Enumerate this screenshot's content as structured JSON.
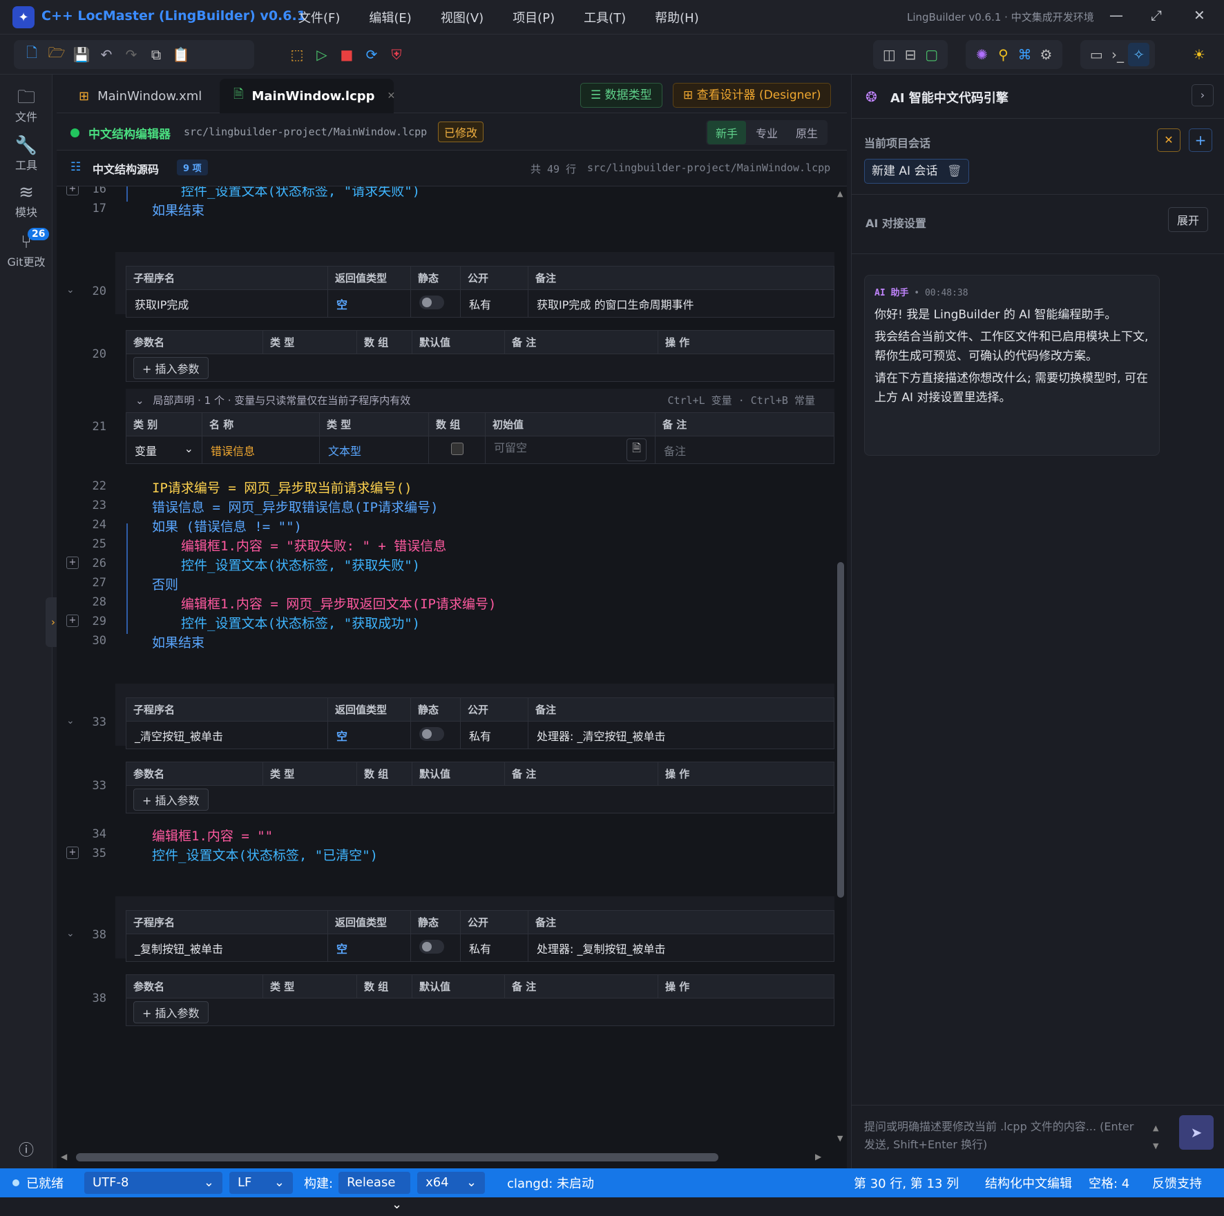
{
  "app": {
    "logo": "logo-icon",
    "title": "C++ LocMaster (LingBuilder) v0.6.1",
    "window_title": "LingBuilder v0.6.1 · 中文集成开发环境",
    "menu": [
      "文件(F)",
      "编辑(E)",
      "视图(V)",
      "项目(P)",
      "工具(T)",
      "帮助(H)"
    ]
  },
  "activity": {
    "files": "文件",
    "tools": "工具",
    "modules": "模块",
    "git": "Git更改",
    "git_badge": "26"
  },
  "tabs": [
    {
      "label": "MainWindow.xml"
    },
    {
      "label": "MainWindow.lcpp"
    }
  ],
  "tab_actions": {
    "data_types": "数据类型",
    "designer": "查看设计器 (Designer)"
  },
  "crumb": {
    "editor_name": "中文结构编辑器",
    "path": "src/lingbuilder-project/MainWindow.lcpp",
    "modified": "已修改",
    "modes": [
      "新手",
      "专业",
      "原生"
    ],
    "active_mode": "新手"
  },
  "source": {
    "title": "中文结构源码",
    "count": "9 项",
    "lines": "共 49 行",
    "path": "src/lingbuilder-project/MainWindow.lcpp"
  },
  "code_top": {
    "l16_num": "16",
    "l16": "控件_设置文本(状态标签, \"请求失败\")",
    "l17_num": "17",
    "l17": "如果结束"
  },
  "sub_headers": [
    "子程序名",
    "返回值类型",
    "静态",
    "公开",
    "备注"
  ],
  "param_headers": [
    "参数名",
    "类 型",
    "数 组",
    "默认值",
    "备 注",
    "操 作"
  ],
  "insert_param": "+ 插入参数",
  "sub1": {
    "line": "20",
    "name": "获取IP完成",
    "ret": "空",
    "access": "私有",
    "note": "获取IP完成 的窗口生命周期事件",
    "param_line": "20"
  },
  "local_decl": {
    "title": "局部声明 · 1 个 · 变量与只读常量仅在当前子程序内有效",
    "shortcut": "Ctrl+L 变量 · Ctrl+B 常量",
    "line": "21",
    "headers": [
      "类 别",
      "名 称",
      "类 型",
      "数 组",
      "初始值",
      "备 注"
    ],
    "kind": "变量",
    "name": "错误信息",
    "type": "文本型",
    "init_placeholder": "可留空",
    "note_placeholder": "备注"
  },
  "code_mid": [
    {
      "n": "22",
      "t": "IP请求编号 = 网页_异步取当前请求编号()"
    },
    {
      "n": "23",
      "t": "错误信息 = 网页_异步取错误信息(IP请求编号)"
    },
    {
      "n": "24",
      "t": "如果 (错误信息 != \"\")"
    },
    {
      "n": "25",
      "t": "编辑框1.内容 = \"获取失败: \" + 错误信息"
    },
    {
      "n": "26",
      "t": "控件_设置文本(状态标签, \"获取失败\")"
    },
    {
      "n": "27",
      "t": "否则"
    },
    {
      "n": "28",
      "t": "编辑框1.内容 = 网页_异步取返回文本(IP请求编号)"
    },
    {
      "n": "29",
      "t": "控件_设置文本(状态标签, \"获取成功\")"
    },
    {
      "n": "30",
      "t": "如果结束"
    }
  ],
  "sub2": {
    "line": "33",
    "name": "_清空按钮_被单击",
    "ret": "空",
    "access": "私有",
    "note": "处理器: _清空按钮_被单击",
    "param_line": "33"
  },
  "code_low": [
    {
      "n": "34",
      "t": "编辑框1.内容 = \"\""
    },
    {
      "n": "35",
      "t": "控件_设置文本(状态标签, \"已清空\")"
    }
  ],
  "sub3": {
    "line": "38",
    "name": "_复制按钮_被单击",
    "ret": "空",
    "access": "私有",
    "note": "处理器: _复制按钮_被单击",
    "param_line": "38"
  },
  "ai": {
    "title": "AI 智能中文代码引擎",
    "session_label": "当前项目会话",
    "new_session": "新建 AI 会话",
    "settings_label": "AI 对接设置",
    "expand": "展开",
    "sender": "AI 助手",
    "time": "00:48:38",
    "msg1": "你好! 我是 LingBuilder 的 AI 智能编程助手。",
    "msg2": "我会结合当前文件、工作区文件和已启用模块上下文, 帮你生成可预览、可确认的代码修改方案。",
    "msg3": "请在下方直接描述你想改什么; 需要切换模型时, 可在上方 AI 对接设置里选择。",
    "input_placeholder": "提问或明确描述要修改当前 .lcpp 文件的内容... (Enter 发送, Shift+Enter 换行)"
  },
  "status": {
    "ready": "已就绪",
    "encoding": "UTF-8",
    "eol": "LF",
    "build_label": "构建:",
    "build": "Release",
    "arch": "x64",
    "clangd": "clangd: 未启动",
    "position": "第 30 行, 第 13 列",
    "mode": "结构化中文编辑",
    "indent": "空格: 4",
    "feedback": "反馈支持"
  },
  "colors": {
    "accent": "#1677e8",
    "keyword": "#5aa7ff",
    "identifier": "#ffd34f",
    "member": "#ff5aa0",
    "comment": "#60c060"
  }
}
